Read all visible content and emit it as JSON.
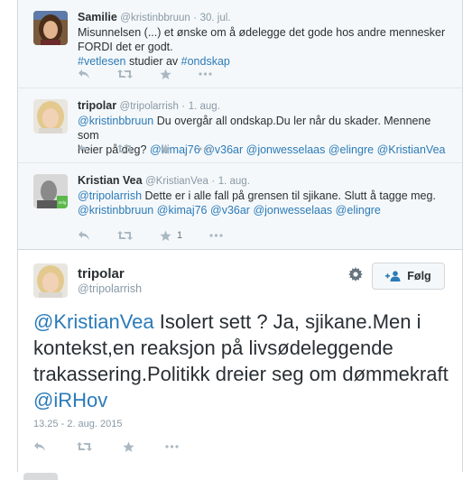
{
  "thread": [
    {
      "name": "Samilie",
      "handle": "@kristinbbruun",
      "time": "30. jul.",
      "line1": "Misunnelsen (...) et ønske om å ødelegge det gode hos andre mennesker",
      "line2": "FORDI det er godt.",
      "hashtag1": "#vetlesen",
      "mid": " studier av ",
      "hashtag2": "#ondskap",
      "avatar": "avatar-woman-dark-hair"
    },
    {
      "name": "tripolar",
      "handle": "@tripolarrish",
      "time": "1. aug.",
      "mention": "@kristinbbruun",
      "text1": " Du overgår all ondskap.Du ler når du skader. Mennene som",
      "text2": "heier på deg? ",
      "mentions2": [
        "@kimaj76",
        "@v36ar",
        "@jonwesselaas",
        "@elingre",
        "@KristianVea"
      ],
      "avatar": "avatar-blonde-woman"
    },
    {
      "name": "Kristian Vea",
      "handle": "@KristianVea",
      "time": "1. aug.",
      "mention": "@tripolarrish",
      "text1": " Dette er i alle fall på grensen til sjikane. Slutt å tagge meg.",
      "mentions2": [
        "@kristinbbruun",
        "@kimaj76",
        "@v36ar",
        "@jonwesselaas",
        "@elingre"
      ],
      "fav_count": "1",
      "avatar": "avatar-man-green-badge"
    }
  ],
  "main": {
    "name": "tripolar",
    "handle": "@tripolarrish",
    "follow_label": "Følg",
    "mention1": "@KristianVea",
    "text1": " Isolert sett ? Ja, sjikane.Men i kontekst,en reaksjon på livsødeleggende trakassering.Politikk dreier seg om dømmekraft ",
    "mention2": "@iRHov",
    "timestamp": "13.25 - 2. aug. 2015"
  },
  "colors": {
    "link": "#2b7bb9",
    "muted": "#8899a6",
    "action_icon": "#aab8c2",
    "thread_bg": "#f5f8fa"
  },
  "icons": [
    "reply-icon",
    "retweet-icon",
    "favorite-icon",
    "more-icon",
    "gear-icon",
    "follow-person-icon"
  ]
}
